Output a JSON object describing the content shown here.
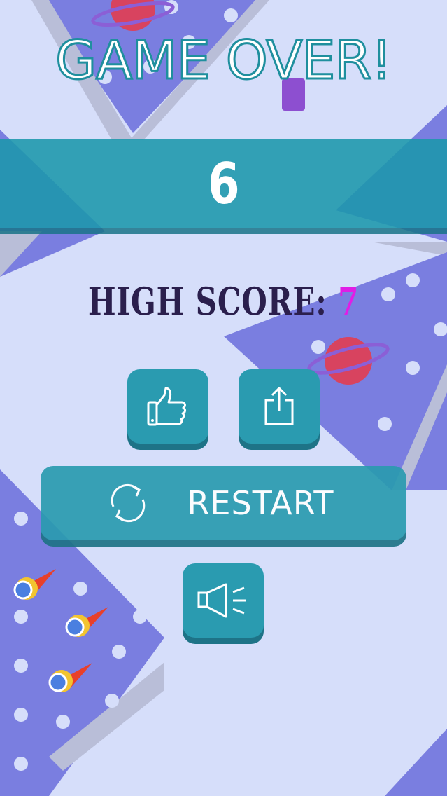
{
  "title": "GAME OVER!",
  "score": "6",
  "high_score": {
    "label": "HIGH SCORE:",
    "value": "7"
  },
  "buttons": {
    "like_icon": "thumbs-up-icon",
    "share_icon": "share-icon",
    "restart_label": "RESTART",
    "restart_icon": "refresh-icon",
    "sound_icon": "speaker-icon"
  },
  "colors": {
    "background": "#d6defa",
    "button": "#2a9bb0",
    "button_shadow": "#1e7387",
    "title_outline": "#1f8f9e",
    "high_score_text": "#2b1f4d",
    "high_score_value": "#e01ee6"
  }
}
